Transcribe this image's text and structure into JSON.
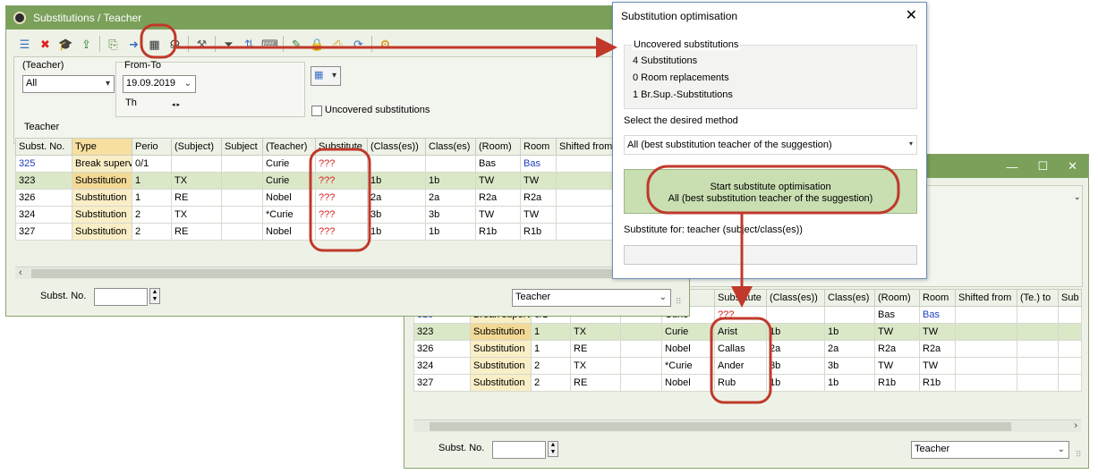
{
  "window1": {
    "title": "Substitutions / Teacher",
    "filter_label": "(Teacher)",
    "filter_value": "All",
    "fromto_label": "From-To",
    "date_value": "19.09.2019",
    "day_value": "Th",
    "uncovered_label": "Uncovered substitutions",
    "group_label": "Teacher",
    "columns": [
      "Subst. No.",
      "Type",
      "Perio",
      "(Subject)",
      "Subject",
      "(Teacher)",
      "Substitute",
      "(Class(es))",
      "Class(es)",
      "(Room)",
      "Room",
      "Shifted from"
    ],
    "rows": [
      [
        "325",
        "Break superv",
        "0/1",
        "",
        "",
        "Curie",
        "???",
        "",
        "",
        "Bas",
        "Bas",
        ""
      ],
      [
        "323",
        "Substitution",
        "1",
        "TX",
        "",
        "Curie",
        "???",
        "1b",
        "1b",
        "TW",
        "TW",
        ""
      ],
      [
        "326",
        "Substitution",
        "1",
        "RE",
        "",
        "Nobel",
        "???",
        "2a",
        "2a",
        "R2a",
        "R2a",
        ""
      ],
      [
        "324",
        "Substitution",
        "2",
        "TX",
        "",
        "*Curie",
        "???",
        "3b",
        "3b",
        "TW",
        "TW",
        ""
      ],
      [
        "327",
        "Substitution",
        "2",
        "RE",
        "",
        "Nobel",
        "???",
        "1b",
        "1b",
        "R1b",
        "R1b",
        ""
      ]
    ],
    "footer_label": "Subst. No.",
    "footer_combo": "Teacher"
  },
  "dialog": {
    "title": "Substitution optimisation",
    "close": "✕",
    "group_title": "Uncovered substitutions",
    "counts": [
      "4 Substitutions",
      "0 Room replacements",
      "1 Br.Sup.-Substitutions"
    ],
    "method_label": "Select the desired method",
    "method_value": "All (best substitution teacher of the suggestion)",
    "button_line1": "Start substitute optimisation",
    "button_line2": "All (best substitution teacher of the suggestion)",
    "substitute_for_label": "Substitute for: teacher (subject/class(es))"
  },
  "window2": {
    "controls": [
      "—",
      "☐",
      "✕"
    ],
    "columns": [
      "",
      "",
      "",
      "",
      "",
      "her)",
      "Substitute",
      "(Class(es))",
      "Class(es)",
      "(Room)",
      "Room",
      "Shifted from",
      "(Te.) to",
      "Sub"
    ],
    "rows": [
      [
        "325",
        "Break superv",
        "0/1",
        "",
        "",
        "Curie",
        "???",
        "",
        "",
        "Bas",
        "Bas",
        "",
        "",
        ""
      ],
      [
        "323",
        "Substitution",
        "1",
        "TX",
        "",
        "Curie",
        "Arist",
        "1b",
        "1b",
        "TW",
        "TW",
        "",
        "",
        ""
      ],
      [
        "326",
        "Substitution",
        "1",
        "RE",
        "",
        "Nobel",
        "Callas",
        "2a",
        "2a",
        "R2a",
        "R2a",
        "",
        "",
        ""
      ],
      [
        "324",
        "Substitution",
        "2",
        "TX",
        "",
        "*Curie",
        "Ander",
        "3b",
        "3b",
        "TW",
        "TW",
        "",
        "",
        ""
      ],
      [
        "327",
        "Substitution",
        "2",
        "RE",
        "",
        "Nobel",
        "Rub",
        "1b",
        "1b",
        "R1b",
        "R1b",
        "",
        "",
        ""
      ]
    ],
    "footer_label": "Subst. No.",
    "footer_combo": "Teacher"
  },
  "colors": {
    "titlebar": "#7aa05a",
    "highlight": "#c0392b",
    "type_header": "#f7dfa0",
    "optimise_button": "#c9dfb2"
  }
}
